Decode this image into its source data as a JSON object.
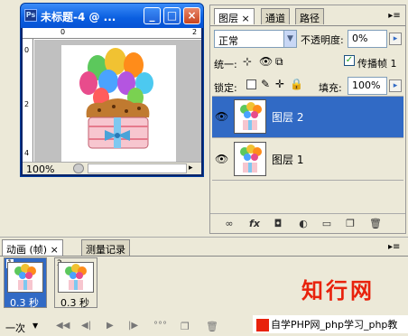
{
  "document": {
    "title": "未标题-4 @ ...",
    "app_icon": "ps-icon",
    "zoom": "100%",
    "ruler_top": [
      "0",
      "2"
    ],
    "ruler_left": [
      "0",
      "2",
      "4"
    ]
  },
  "layers_panel": {
    "tabs": [
      {
        "label": "图层",
        "close": "×"
      },
      {
        "label": "通道"
      },
      {
        "label": "路径"
      }
    ],
    "blend_mode": "正常",
    "opacity_label": "不透明度:",
    "opacity_value": "0%",
    "unify_label": "统一:",
    "propagate_label": "传播帧 1",
    "lock_label": "锁定:",
    "fill_label": "填充:",
    "fill_value": "100%",
    "layers": [
      {
        "name": "图层 2",
        "selected": true
      },
      {
        "name": "图层 1",
        "selected": false
      }
    ]
  },
  "animation_panel": {
    "tabs": [
      {
        "label": "动画 (帧)"
      },
      {
        "label": "测量记录"
      }
    ],
    "frames": [
      {
        "number": "1",
        "delay": "0.3 秒",
        "selected": true
      },
      {
        "number": "2",
        "delay": "0.3 秒",
        "selected": false
      }
    ],
    "loop": "一次"
  },
  "watermark": {
    "title": "知行网",
    "caption": "自学PHP网_php学习_php教"
  },
  "colors": {
    "titlebar": "#0a5ee0",
    "selection": "#316ac5",
    "watermark_red": "#e8220c"
  }
}
